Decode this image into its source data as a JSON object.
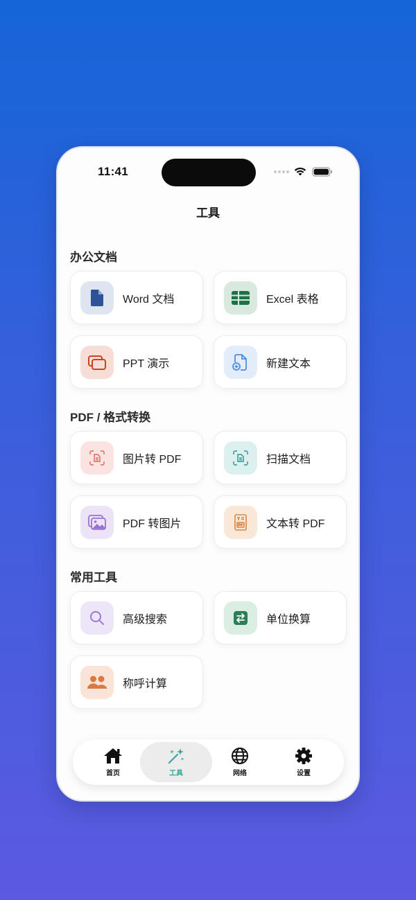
{
  "status_bar": {
    "time": "11:41"
  },
  "nav": {
    "title": "工具"
  },
  "sections": [
    {
      "title": "办公文档"
    },
    {
      "title": "PDF / 格式转换"
    },
    {
      "title": "常用工具"
    }
  ],
  "tools": {
    "word": {
      "label": "Word 文档",
      "icon": "document-icon",
      "color": "#2c5397",
      "bg": "#dfe5f0"
    },
    "excel": {
      "label": "Excel 表格",
      "icon": "table-icon",
      "color": "#1e7045",
      "bg": "#d9e9e0"
    },
    "ppt": {
      "label": "PPT 演示",
      "icon": "slides-icon",
      "color": "#c9431f",
      "bg": "#f6ded7"
    },
    "new_text": {
      "label": "新建文本",
      "icon": "file-add-icon",
      "color": "#4d8de2",
      "bg": "#e3edfa"
    },
    "image_to_pdf": {
      "label": "图片转 PDF",
      "icon": "scan-image-icon",
      "color": "#e07a72",
      "bg": "#fbe3e1"
    },
    "scan_doc": {
      "label": "扫描文档",
      "icon": "scan-document-icon",
      "color": "#3ba7a0",
      "bg": "#dcf1ef"
    },
    "pdf_to_image": {
      "label": "PDF 转图片",
      "icon": "images-icon",
      "color": "#9a72d2",
      "bg": "#ece3f7"
    },
    "text_to_pdf": {
      "label": "文本转 PDF",
      "icon": "text-pdf-icon",
      "color": "#d9873d",
      "bg": "#f9e8d8"
    },
    "advanced_search": {
      "label": "高级搜索",
      "icon": "search-icon",
      "color": "#9b78dc",
      "bg": "#ede6f9"
    },
    "unit_convert": {
      "label": "单位换算",
      "icon": "convert-icon",
      "color": "#2f7d55",
      "bg": "#dbeee3"
    },
    "kinship_calc": {
      "label": "称呼计算",
      "icon": "people-icon",
      "color": "#d97a42",
      "bg": "#f9e4d7"
    }
  },
  "tab_bar": {
    "tabs": [
      {
        "label": "首页",
        "icon": "home-icon"
      },
      {
        "label": "工具",
        "icon": "magic-wand-icon",
        "active": true
      },
      {
        "label": "网络",
        "icon": "globe-icon"
      },
      {
        "label": "设置",
        "icon": "gear-icon"
      }
    ],
    "active_color": "#3aa59c"
  }
}
